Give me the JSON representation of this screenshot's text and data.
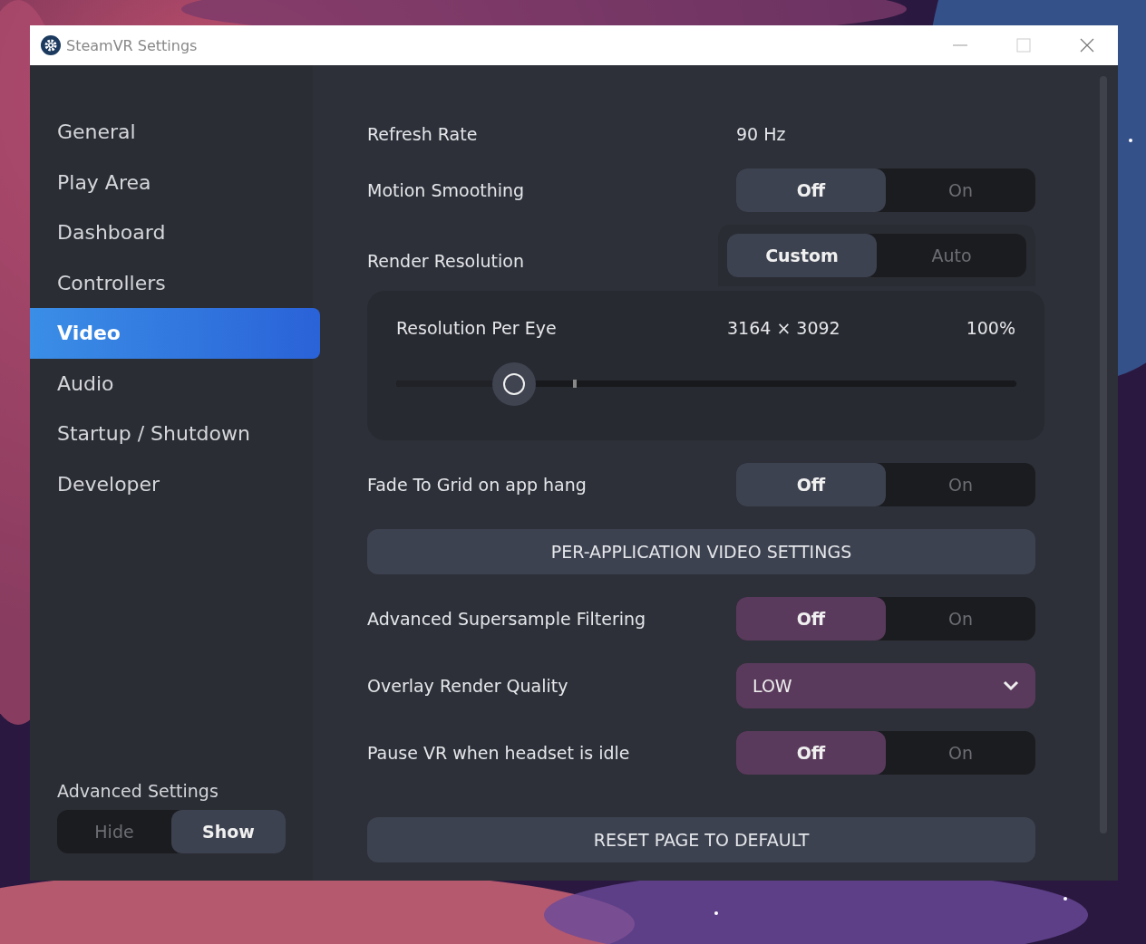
{
  "window": {
    "title": "SteamVR Settings"
  },
  "sidebar": {
    "items": [
      {
        "label": "General",
        "selected": false
      },
      {
        "label": "Play Area",
        "selected": false
      },
      {
        "label": "Dashboard",
        "selected": false
      },
      {
        "label": "Controllers",
        "selected": false
      },
      {
        "label": "Video",
        "selected": true
      },
      {
        "label": "Audio",
        "selected": false
      },
      {
        "label": "Startup / Shutdown",
        "selected": false
      },
      {
        "label": "Developer",
        "selected": false
      }
    ],
    "advanced_settings": {
      "label": "Advanced Settings",
      "options": [
        {
          "label": "Hide",
          "selected": false
        },
        {
          "label": "Show",
          "selected": true
        }
      ]
    }
  },
  "settings": [
    {
      "kind": "text",
      "label": "Refresh Rate",
      "value": "90 Hz"
    },
    {
      "kind": "toggle",
      "label": "Motion Smoothing",
      "advanced": false,
      "options": [
        {
          "label": "Off",
          "selected": true
        },
        {
          "label": "On",
          "selected": false
        }
      ]
    },
    {
      "kind": "resolution",
      "label": "Render Resolution",
      "advanced": false,
      "options": [
        {
          "label": "Custom",
          "selected": true
        },
        {
          "label": "Auto",
          "selected": false
        }
      ],
      "slider": {
        "label": "Resolution Per Eye",
        "resolution": "3164 × 3092",
        "percent": "100%",
        "level": 0.19
      }
    },
    {
      "kind": "toggle",
      "label": "Fade To Grid on app hang",
      "advanced": false,
      "options": [
        {
          "label": "Off",
          "selected": true
        },
        {
          "label": "On",
          "selected": false
        }
      ]
    },
    {
      "kind": "button",
      "label": "PER-APPLICATION VIDEO SETTINGS"
    },
    {
      "kind": "toggle",
      "label": "Advanced Supersample Filtering",
      "advanced": true,
      "options": [
        {
          "label": "Off",
          "selected": true
        },
        {
          "label": "On",
          "selected": false
        }
      ]
    },
    {
      "kind": "dropdown",
      "label": "Overlay Render Quality",
      "advanced": true,
      "value": "LOW"
    },
    {
      "kind": "toggle",
      "label": "Pause VR when headset is idle",
      "advanced": true,
      "options": [
        {
          "label": "Off",
          "selected": true
        },
        {
          "label": "On",
          "selected": false
        }
      ]
    }
  ],
  "reset_button": "RESET PAGE TO DEFAULT"
}
